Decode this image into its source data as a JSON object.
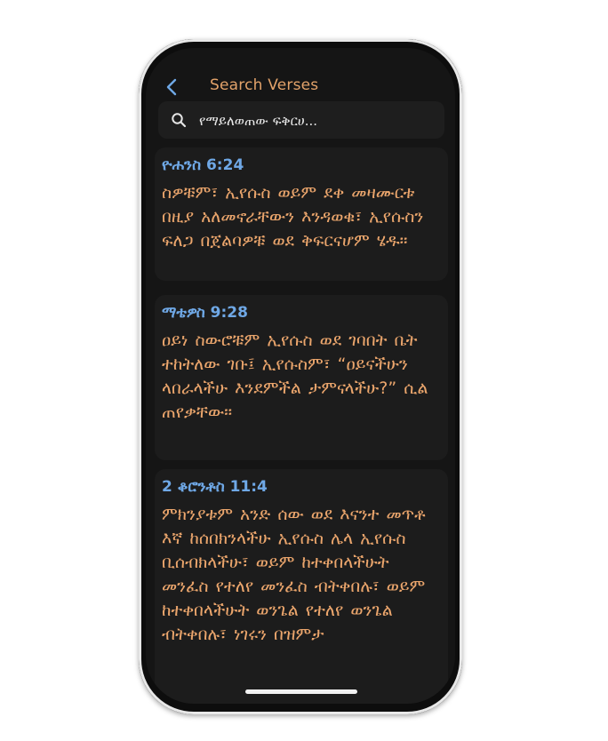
{
  "header": {
    "title": "Search Verses",
    "back_icon": "chevron-left-icon"
  },
  "search": {
    "value": "የማይለወጠው ፍቅርሀ...",
    "icon": "search-icon"
  },
  "results": [
    {
      "reference": "ዮሐንስ 6:24",
      "text": "ስዎቹም፣ ኢየሱስ ወይም ደቀ መዛሙርቱ በዚያ አለመኖራቸውን እንዳወቁ፣ ኢየሱስን ፍለጋ በጀልባዎቹ ወደ ቅፍርናሆም ሄዱ።"
    },
    {
      "reference": "ማቴዎስ 9:28",
      "text": "ዐይነ ስውሮቹም ኢየሱስ ወደ ገባበት ቤት ተከትለው ገቡ፤ ኢየሱስም፣ “ዐይናችሁን ላበራላችሁ እንደምችል ታምናላችሁ?” ሲል ጠየቃቸው።"
    },
    {
      "reference": "2 ቆሮንቶስ 11:4",
      "text": "ምክንያቱም አንድ ሰው ወደ እናንተ መጥቶ እኛ ከሰበክንላችሁ ኢየሱስ ሌላ ኢየሱስ ቢሰብክላችሁ፣ ወይም ከተቀበላችሁት መንፈስ የተለየ መንፈስ ብትቀበሉ፣ ወይም ከተቀበላችሁት ወንጌል የተለየ ወንጌል ብትቀበሉ፣ ነገሩን በዝምታ"
    }
  ],
  "colors": {
    "accent": "#e3a36a",
    "reference": "#6fa8e6",
    "background": "#151515",
    "card": "#1c1c1c"
  }
}
